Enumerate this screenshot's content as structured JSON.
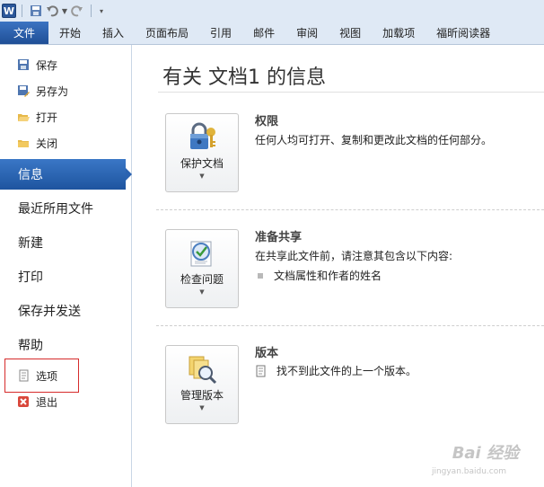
{
  "qat": {
    "app_icon_letter": "W"
  },
  "ribbon": {
    "tabs": [
      {
        "label": "文件"
      },
      {
        "label": "开始"
      },
      {
        "label": "插入"
      },
      {
        "label": "页面布局"
      },
      {
        "label": "引用"
      },
      {
        "label": "邮件"
      },
      {
        "label": "审阅"
      },
      {
        "label": "视图"
      },
      {
        "label": "加载项"
      },
      {
        "label": "福昕阅读器"
      }
    ]
  },
  "backstage": {
    "commands": [
      {
        "label": "保存",
        "icon": "save-icon"
      },
      {
        "label": "另存为",
        "icon": "save-as-icon"
      },
      {
        "label": "打开",
        "icon": "open-folder-icon"
      },
      {
        "label": "关闭",
        "icon": "close-folder-icon"
      }
    ],
    "nav": [
      {
        "label": "信息",
        "active": true
      },
      {
        "label": "最近所用文件"
      },
      {
        "label": "新建"
      },
      {
        "label": "打印"
      },
      {
        "label": "保存并发送"
      },
      {
        "label": "帮助"
      }
    ],
    "bottom_commands": [
      {
        "label": "选项",
        "icon": "options-icon"
      },
      {
        "label": "退出",
        "icon": "exit-icon"
      }
    ]
  },
  "main": {
    "title": "有关 文档1 的信息",
    "sections": [
      {
        "button_label": "保护文档",
        "heading": "权限",
        "description": "任何人均可打开、复制和更改此文档的任何部分。",
        "icon": "lock-key-icon"
      },
      {
        "button_label": "检查问题",
        "heading": "准备共享",
        "description": "在共享此文件前，请注意其包含以下内容:",
        "bullet": "文档属性和作者的姓名",
        "icon": "checklist-icon"
      },
      {
        "button_label": "管理版本",
        "heading": "版本",
        "bullet": "找不到此文件的上一个版本。",
        "icon": "versions-icon"
      }
    ]
  },
  "watermark": {
    "text": "Bai 经验",
    "subtext": "jingyan.baidu.com"
  },
  "colors": {
    "accent": "#2a5ea8",
    "highlight": "#d62b2b",
    "ribbon_bg": "#dfe9f5"
  }
}
